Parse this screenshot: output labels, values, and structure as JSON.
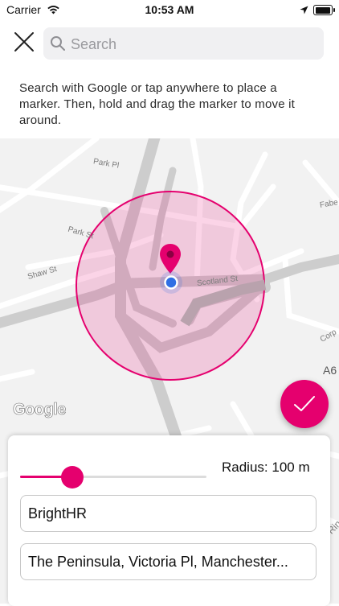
{
  "status_bar": {
    "carrier": "Carrier",
    "time": "10:53 AM",
    "battery_level": 0.95
  },
  "header": {
    "search_placeholder": "Search",
    "hint": "Search with Google or tap anywhere to place a marker. Then, hold and drag the marker to move it around."
  },
  "map": {
    "streets": {
      "park_pl": "Park Pl",
      "park_st": "Park St",
      "shaw_st": "Shaw St",
      "scotland_st": "Scotland St",
      "fabe": "Fabe",
      "corp": "Corp",
      "a6": "A6",
      "rin": "Rin"
    },
    "attribution": "Google",
    "geofence_color": "#e5006e"
  },
  "controls": {
    "radius_label": "Radius: 100 m",
    "radius_fraction": 0.28,
    "name_value": "BrightHR",
    "address_value": "The Peninsula, Victoria Pl, Manchester..."
  },
  "icons": {
    "close": "close-icon",
    "search": "search-icon",
    "confirm": "checkmark-icon",
    "pin": "map-pin-icon"
  },
  "colors": {
    "accent": "#e5006e",
    "location_dot": "#2f6fe4"
  }
}
